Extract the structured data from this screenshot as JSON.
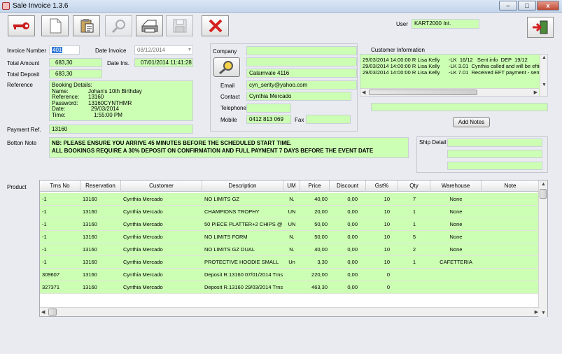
{
  "window": {
    "title": "Sale Invoice 1.3.6",
    "min": "–",
    "max": "□",
    "close": "x"
  },
  "user": {
    "label": "User",
    "value": "KART2000 Int."
  },
  "invoice": {
    "number_label": "Invoice Number",
    "number": "401",
    "date_label": "Date Invoice",
    "date": "08/12/2014",
    "total_amount_label": "Total Amount",
    "total_amount": "683,30",
    "date_ins_label": "Date Ins.",
    "date_ins": "07/01/2014 11:41:28",
    "total_deposit_label": "Total Deposit",
    "total_deposit": "683,30",
    "reference_label": "Reference",
    "booking": {
      "l1": "Booking Details:",
      "l2k": "Name:",
      "l2v": "Johan's 10th Birthday",
      "l3k": "Reference:",
      "l3v": "13160",
      "l4k": "Password:",
      "l4v": "13160CYNTHMR",
      "l5k": "Date:",
      "l5v": "29/03/2014",
      "l6k": "Time:",
      "l6v": "1:55:00 PM"
    },
    "payment_ref_label": "Payment Ref.",
    "payment_ref": "13160",
    "bottom_note_label": "Botton Note",
    "bottom_note_1": "NB: PLEASE ENSURE YOU ARRIVE 45 MINUTES BEFORE THE SCHEDULED START TIME.",
    "bottom_note_2": "ALL BOOKINGS REQUIRE A 30% DEPOSIT ON CONFIRMATION AND FULL PAYMENT 7 DAYS BEFORE THE EVENT DATE"
  },
  "customer": {
    "company_label": "Company",
    "company": "",
    "address": "Calamvale  4116",
    "email_label": "Email",
    "email": "cyn_serity@yahoo.com",
    "contact_label": "Contact",
    "contact": "Cynthia Mercado",
    "telephone_label": "Telephone",
    "telephone": "",
    "mobile_label": "Mobile",
    "mobile": "0412 813 069",
    "fax_label": "Fax",
    "fax": ""
  },
  "customer_info": {
    "title": "Customer Information",
    "lines": [
      "29/03/2014 14:00:00 R Lisa Kelly      -LK  16/12   Sent info  DEP  19/12",
      "29/03/2014 14:00:00 R Lisa Kelly      -LK 3.01  Cynthia called and will be eftir",
      "29/03/2014 14:00:00 R Lisa Kelly      -LK 7.01  Received EFT payment - sent"
    ],
    "add_notes": "Add Notes"
  },
  "ship_detail_label": "Ship Detail",
  "product_label": "Product",
  "grid": {
    "headers": [
      "Trns No",
      "Reservation",
      "Customer",
      "Description",
      "UM",
      "Price",
      "Discount",
      "Gst%",
      "Qty",
      "Warehouse",
      "Note"
    ],
    "rows": [
      [
        "-1",
        "13160",
        "Cynthia Mercado",
        "NO LIMITS GZ",
        "N.",
        "40,00",
        "0,00",
        "10",
        "7",
        "None",
        ""
      ],
      [
        "-1",
        "13160",
        "Cynthia Mercado",
        "CHAMPIONS TROPHY",
        "UN",
        "20,00",
        "0,00",
        "10",
        "1",
        "None",
        ""
      ],
      [
        "-1",
        "13160",
        "Cynthia Mercado",
        "50 PIECE PLATTER+2 CHIPS @ $P",
        "UN",
        "50,00",
        "0,00",
        "10",
        "1",
        "None",
        ""
      ],
      [
        "-1",
        "13160",
        "Cynthia Mercado",
        "NO LIMITS FORM",
        "N.",
        "50,00",
        "0,00",
        "10",
        "5",
        "None",
        ""
      ],
      [
        "-1",
        "13160",
        "Cynthia Mercado",
        "NO LIMITS  GZ DUAL",
        "N.",
        "40,00",
        "0,00",
        "10",
        "2",
        "None",
        ""
      ],
      [
        "-1",
        "13160",
        "Cynthia Mercado",
        "PROTECTIVE HOODIE SMALL",
        "Un",
        "3,30",
        "0,00",
        "10",
        "1",
        "CAFETTERIA",
        ""
      ],
      [
        "309607",
        "13160",
        "Cynthia Mercado",
        "Deposit R.13160 07/01/2014 Trns Nc",
        "",
        "220,00",
        "0,00",
        "0",
        "",
        "",
        ""
      ],
      [
        "327371",
        "13160",
        "Cynthia Mercado",
        "Deposit R.13160 29/03/2014 Trns Nc",
        "",
        "463,30",
        "0,00",
        "0",
        "",
        "",
        ""
      ]
    ]
  },
  "colors": {
    "field_green": "#ccffb4",
    "close_red": "#d62020"
  }
}
